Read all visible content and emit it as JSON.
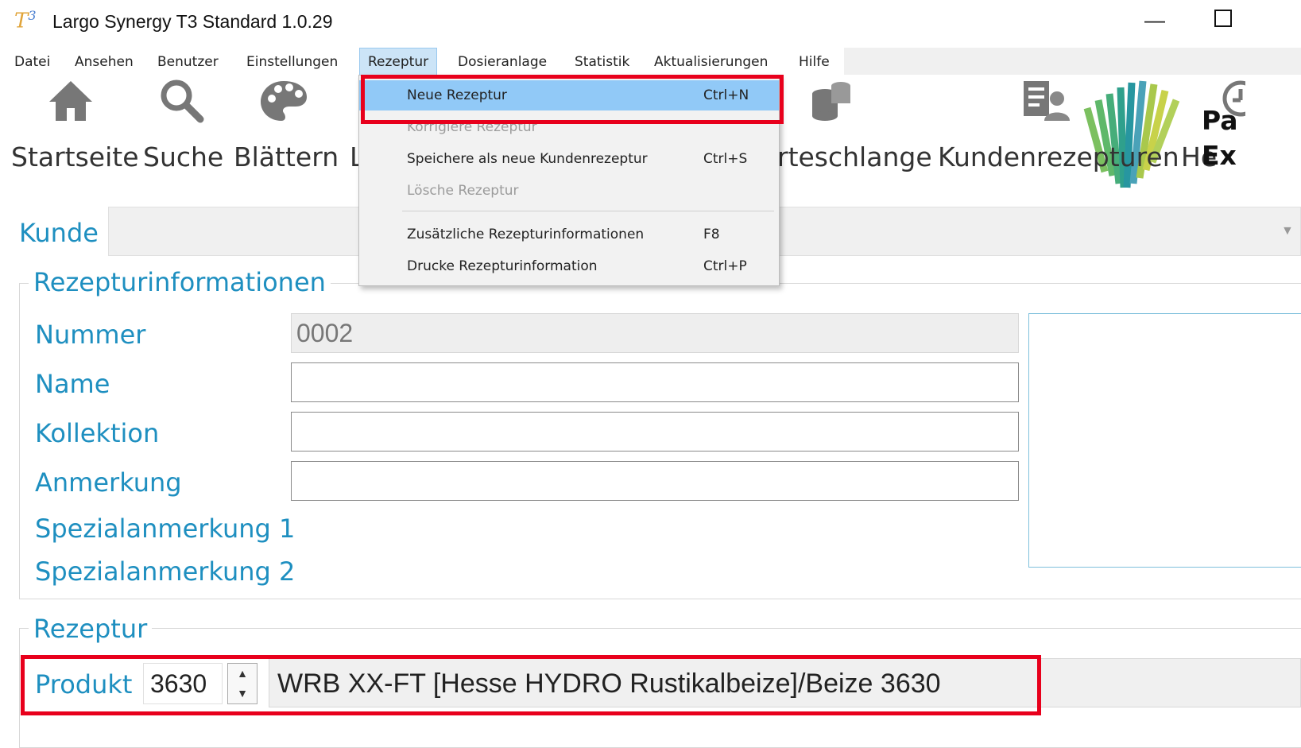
{
  "window": {
    "logo_text": "T",
    "logo_sup": "3",
    "title": "Largo Synergy T3 Standard 1.0.29",
    "minimize_glyph": "—"
  },
  "menubar": {
    "items": [
      "Datei",
      "Ansehen",
      "Benutzer",
      "Einstellungen",
      "Rezeptur",
      "Dosieranlage",
      "Statistik",
      "Aktualisierungen",
      "Hilfe"
    ],
    "active": "Rezeptur"
  },
  "toolbar": {
    "startseite": "Startseite",
    "suche": "Suche",
    "blaettern": "Blättern",
    "partial_l": "L",
    "warteschlange": "rteschlange",
    "kundenrezepturen": "Kundenrezepturen",
    "partial_he": "He",
    "partial_pa": "Pa",
    "partial_ex": "Ex"
  },
  "dropdown": {
    "items": [
      {
        "label": "Neue Rezeptur",
        "shortcut": "Ctrl+N",
        "state": "hover"
      },
      {
        "label": "Korrigiere Rezeptur",
        "shortcut": "",
        "state": "disabled"
      },
      {
        "label": "Speichere als neue Kundenrezeptur",
        "shortcut": "Ctrl+S",
        "state": "normal"
      },
      {
        "label": "Lösche Rezeptur",
        "shortcut": "",
        "state": "disabled"
      },
      {
        "label": "Zusätzliche Rezepturinformationen",
        "shortcut": "F8",
        "state": "normal"
      },
      {
        "label": "Drucke Rezepturinformation",
        "shortcut": "Ctrl+P",
        "state": "normal"
      }
    ]
  },
  "kunde": {
    "label": "Kunde",
    "value": ""
  },
  "rezepturinfo": {
    "title": "Rezepturinformationen",
    "nummer_label": "Nummer",
    "nummer_value": "0002",
    "name_label": "Name",
    "name_value": "",
    "kollektion_label": "Kollektion",
    "kollektion_value": "",
    "anmerkung_label": "Anmerkung",
    "anmerkung_value": "",
    "spezial1_label": "Spezialanmerkung 1",
    "spezial2_label": "Spezialanmerkung 2"
  },
  "rezeptur": {
    "title": "Rezeptur",
    "produkt_label": "Produkt",
    "produkt_number": "3630",
    "produkt_name": "WRB XX-FT [Hesse HYDRO Rustikalbeize]/Beize 3630"
  },
  "colors": {
    "accent": "#1e8fc0",
    "highlight": "#e8001c",
    "menu_hover": "#91c9f7"
  }
}
